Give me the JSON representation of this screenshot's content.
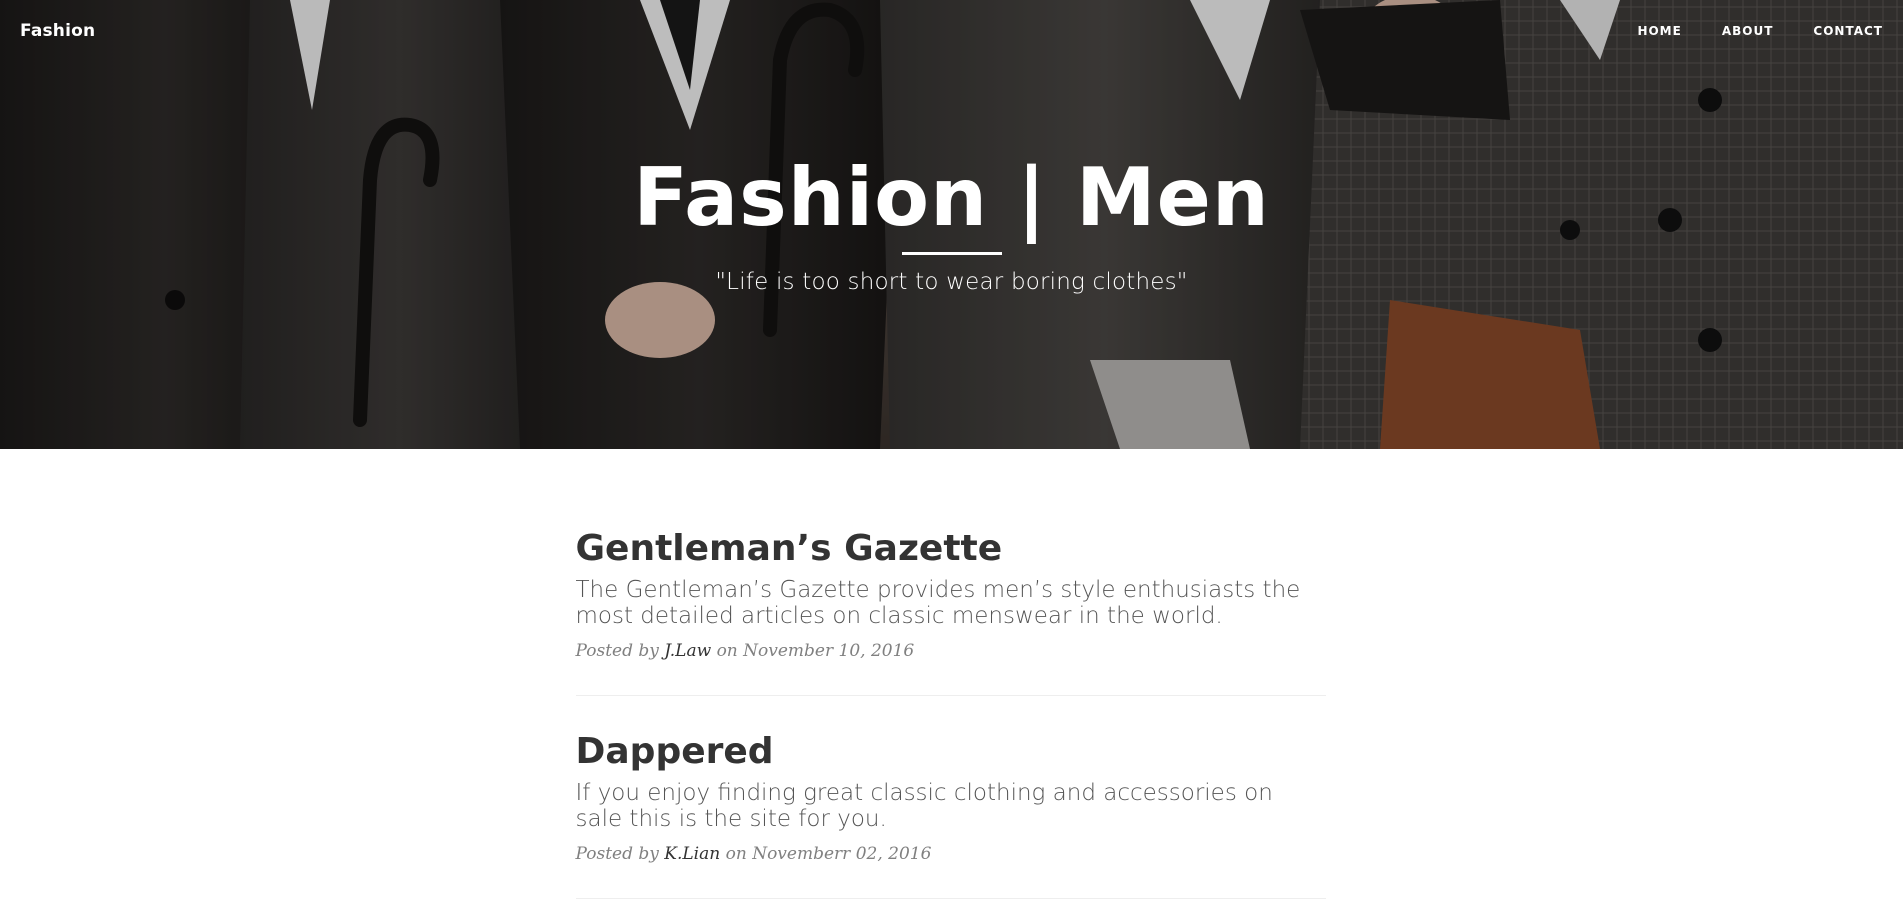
{
  "navbar": {
    "brand": "Fashion",
    "links": [
      {
        "label": "HOME"
      },
      {
        "label": "ABOUT"
      },
      {
        "label": "CONTACT"
      }
    ]
  },
  "hero": {
    "title": "Fashion | Men",
    "subtitle": "\"Life is too short to wear boring clothes\""
  },
  "posts": [
    {
      "title": "Gentleman’s Gazette",
      "subtitle": "The Gentleman’s Gazette provides men’s style enthusiasts the most detailed articles on classic menswear in the world.",
      "meta_prefix": "Posted by",
      "author": "J.Law",
      "meta_suffix": "on November 10, 2016"
    },
    {
      "title": "Dappered",
      "subtitle": "If you enjoy finding great classic clothing and accessories on sale this is the site for you.",
      "meta_prefix": "Posted by",
      "author": "K.Lian",
      "meta_suffix": "on Novemberr 02, 2016"
    }
  ]
}
